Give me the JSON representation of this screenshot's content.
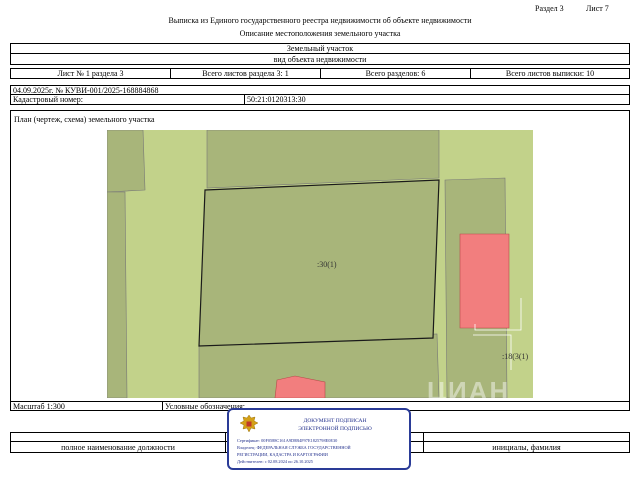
{
  "header": {
    "section": "Раздел 3",
    "sheet": "Лист 7",
    "title": "Выписка из Единого государственного реестра недвижимости об объекте недвижимости",
    "subtitle": "Описание местоположения земельного участка"
  },
  "object": {
    "type": "Земельный участок",
    "type_caption": "вид объекта недвижимости"
  },
  "sheet_info": {
    "sheet_of_section": "Лист № 1 раздела 3",
    "total_sheets_section": "Всего листов раздела 3: 1",
    "total_sections": "Всего разделов: 6",
    "total_sheets": "Всего листов выписки: 10"
  },
  "record": {
    "date_number": "04.09.2025г. № КУВИ-001/2025-168884868",
    "cadastral_label": "Кадастровый номер:",
    "cadastral_value": "50:21:0120313:30"
  },
  "plan": {
    "label": "План (чертеж, схема) земельного участка",
    "parcel_label": ":30(1)",
    "neighbor_label": ":18(3(1)",
    "watermark": "ЦИАН"
  },
  "footer": {
    "scale": "Масштаб 1:300",
    "legend": "Условные обозначения:",
    "position_caption": "полное наименование должности",
    "name_caption": "инициалы, фамилия"
  },
  "stamp": {
    "title_line1": "ДОКУМЕНТ ПОДПИСАН",
    "title_line2": "ЭЛЕКТРОННОЙ ПОДПИСЬЮ",
    "certificate": "Сертификат: 00F0588C161A9D8B4F97E1825798E0E30",
    "issuer_line1": "Владелец: ФЕДЕРАЛЬНАЯ СЛУЖБА ГОСУДАРСТВЕННОЙ",
    "issuer_line2": "РЕГИСТРАЦИИ, КАДАСТРА И КАРТОГРАФИИ",
    "validity": "Действителен: с 02.08.2024 по 26.10.2025"
  },
  "colors": {
    "map_background": "#c2d28a",
    "parcel_fill": "#a8b57a",
    "building_fill": "#f27e7e",
    "stamp_border": "#2a3b97"
  }
}
